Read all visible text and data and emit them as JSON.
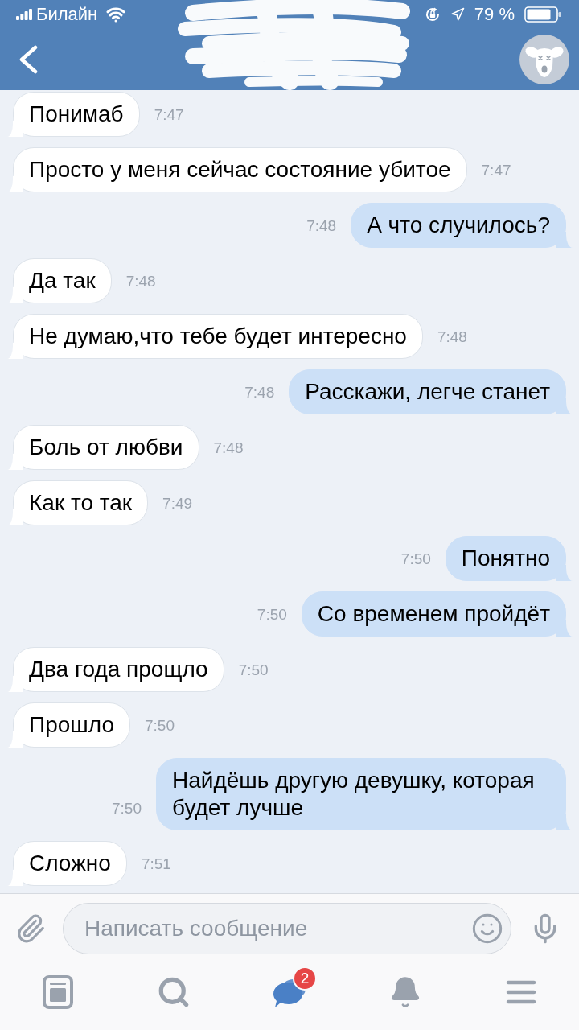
{
  "status_bar": {
    "carrier": "Билайн",
    "battery": "79 %"
  },
  "messages": [
    {
      "kind": "incoming",
      "text": "Понимаб",
      "time": "7:47"
    },
    {
      "kind": "incoming",
      "text": "Просто у меня сейчас состояние убитое",
      "time": "7:47"
    },
    {
      "kind": "outgoing",
      "text": "А что случилось?",
      "time": "7:48"
    },
    {
      "kind": "incoming",
      "text": "Да так",
      "time": "7:48"
    },
    {
      "kind": "incoming",
      "text": "Не думаю,что тебе будет интересно",
      "time": "7:48"
    },
    {
      "kind": "outgoing",
      "text": "Расскажи, легче станет",
      "time": "7:48"
    },
    {
      "kind": "incoming",
      "text": "Боль от любви",
      "time": "7:48"
    },
    {
      "kind": "incoming",
      "text": "Как то так",
      "time": "7:49"
    },
    {
      "kind": "outgoing",
      "text": "Понятно",
      "time": "7:50"
    },
    {
      "kind": "outgoing",
      "text": "Со временем пройдёт",
      "time": "7:50"
    },
    {
      "kind": "incoming",
      "text": "Два года прощло",
      "time": "7:50"
    },
    {
      "kind": "incoming",
      "text": "Прошло",
      "time": "7:50"
    },
    {
      "kind": "outgoing",
      "text": "Найдёшь другую девушку, которая будет лучше",
      "time": "7:50"
    },
    {
      "kind": "incoming",
      "text": "Сложно",
      "time": "7:51"
    }
  ],
  "composer": {
    "placeholder": "Написать сообщение"
  },
  "tab_bar": [
    {
      "selected": false
    },
    {
      "selected": false
    },
    {
      "selected": true,
      "badge": "2"
    },
    {
      "selected": false
    },
    {
      "selected": false
    }
  ]
}
